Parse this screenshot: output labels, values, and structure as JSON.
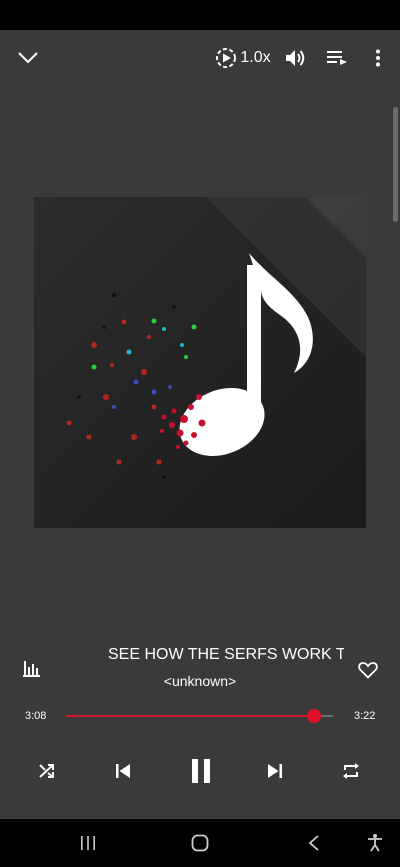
{
  "player": {
    "speed_label": "1.0x",
    "song_title": "SEE HOW THE SERFS WORK T",
    "artist": "<unknown>",
    "elapsed": "3:08",
    "duration": "3:22",
    "progress": 0.93
  },
  "icons": {
    "collapse": "chevron-down-icon",
    "speed": "playback-speed-icon",
    "volume": "volume-icon",
    "queue": "queue-icon",
    "more": "more-vert-icon",
    "equalizer": "equalizer-icon",
    "favorite": "heart-outline-icon",
    "shuffle": "shuffle-icon",
    "previous": "skip-previous-icon",
    "pause": "pause-icon",
    "next": "skip-next-icon",
    "repeat": "repeat-icon",
    "nav_recents": "recents-icon",
    "nav_home": "home-icon",
    "nav_back": "back-icon",
    "accessibility": "accessibility-icon"
  },
  "colors": {
    "background": "#3a3a3a",
    "accent": "#e0102a",
    "system_bar": "#000000"
  }
}
